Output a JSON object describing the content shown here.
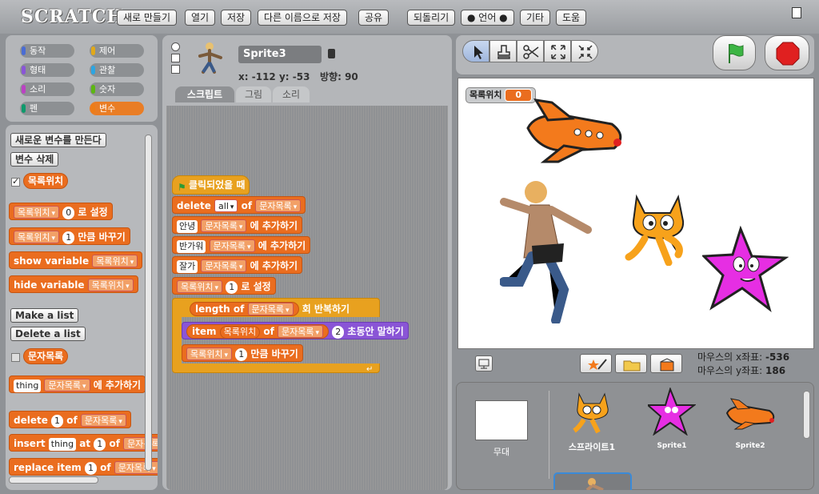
{
  "app": {
    "logo": "SCRATCH"
  },
  "menu": {
    "new": "새로 만들기",
    "open": "열기",
    "save": "저장",
    "save_as": "다른 이름으로 저장",
    "share": "공유",
    "undo": "되돌리기",
    "language": "● 언어 ●",
    "extras": "기타",
    "help": "도움"
  },
  "categories": [
    {
      "label": "동작",
      "color": "#4a6cd4"
    },
    {
      "label": "제어",
      "color": "#e1a91a"
    },
    {
      "label": "형태",
      "color": "#8a55d7"
    },
    {
      "label": "관찰",
      "color": "#2ca5e2"
    },
    {
      "label": "소리",
      "color": "#bb42c3"
    },
    {
      "label": "숫자",
      "color": "#5cb712"
    },
    {
      "label": "펜",
      "color": "#0e9a6c"
    },
    {
      "label": "변수",
      "color": "#ee7d16"
    }
  ],
  "palette": {
    "make_var": "새로운 변수를 만든다",
    "delete_var": "변수 삭제",
    "var_name": "목록위치",
    "set_suffix": "로 설정",
    "change_suffix": "만큼 바꾸기",
    "set_value": "0",
    "change_value": "1",
    "show_var": "show variable",
    "hide_var": "hide variable",
    "make_list": "Make a list",
    "delete_list": "Delete a list",
    "list_name": "문자목록",
    "thing": "thing",
    "add_suffix": "에 추가하기",
    "delete": "delete",
    "of": "of",
    "insert": "insert",
    "at": "at",
    "replace": "replace item",
    "idx": "1"
  },
  "sprite": {
    "name": "Sprite3",
    "x_label": "x:",
    "x": "-112",
    "y_label": "y:",
    "y": "-53",
    "dir_label": "방향:",
    "dir": "90"
  },
  "tabs": [
    "스크립트",
    "그림",
    "소리"
  ],
  "script": {
    "hat": "클릭되었을 때",
    "delete": "delete",
    "all": "all",
    "of": "of",
    "list": "문자목록",
    "items": [
      "안녕",
      "반가워",
      "잘가"
    ],
    "add_suffix": "에 추가하기",
    "var": "목록위치",
    "set_value": "1",
    "set_suffix": "로 설정",
    "length_of": "length of",
    "repeat_suffix": "회 반복하기",
    "item": "item",
    "say_secs": "2",
    "say_suffix": "초동안 말하기",
    "change_value": "1",
    "change_suffix": "만큼 바꾸기"
  },
  "stage": {
    "monitor_label": "목록위치",
    "monitor_value": "0",
    "mouse_x_label": "마우스의 x좌표:",
    "mouse_x": "-536",
    "mouse_y_label": "마우스의 y좌표:",
    "mouse_y": "186"
  },
  "sprite_list": [
    {
      "label": "무대"
    },
    {
      "label": "스프라이트1"
    },
    {
      "label": "Sprite1"
    },
    {
      "label": "Sprite2"
    }
  ],
  "colors": {
    "accent": "#ea6d1f",
    "control": "#e8a11f",
    "looks": "#8a55d6",
    "stop": "#e02020",
    "go": "#3cb544"
  }
}
